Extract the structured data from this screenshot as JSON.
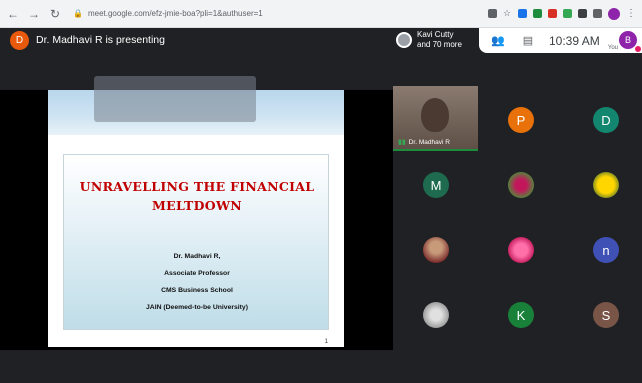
{
  "browser": {
    "url": "meet.google.com/efz-jmie-boa?pli=1&authuser=1"
  },
  "meet": {
    "presenter_initial": "D",
    "presenting_text": "Dr. Madhavi R is presenting",
    "participants_line1": "Kavi Cutty",
    "participants_line2": "and 70 more",
    "clock": "10:39 AM",
    "you_initial": "B",
    "you_label": "You"
  },
  "slide": {
    "title_line1": "UNRAVELLING THE FINANCIAL",
    "title_line2": "MELTDOWN",
    "lines": [
      "Dr. Madhavi R,",
      "Associate Professor",
      "CMS Business School",
      "JAIN (Deemed-to-be University)"
    ],
    "page": "1"
  },
  "tiles": {
    "self_name": "Dr. Madhavi R",
    "p_initial": "P",
    "d_initial": "D",
    "m_initial": "M",
    "n_initial": "n",
    "k_initial": "K",
    "s_initial": "S"
  },
  "colors": {
    "p": "#e8710a",
    "d": "#12866e",
    "m": "#1e6b4f",
    "n": "#3f51b5",
    "k": "#188038",
    "s": "#795548",
    "title_red": "#c00000"
  }
}
